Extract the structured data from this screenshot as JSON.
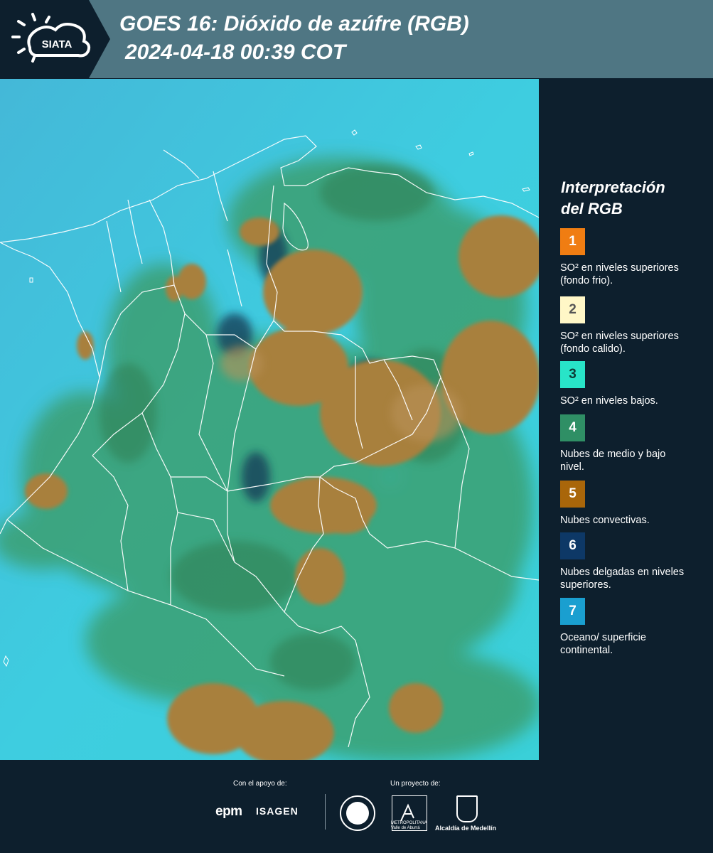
{
  "header": {
    "logo_text": "SIATA",
    "title_line1": "GOES 16: Dióxido de azúfre (RGB)",
    "title_line2": "2024-04-18 00:39 COT"
  },
  "map": {
    "description_icon": "satellite-rgb-image",
    "colors": {
      "background": "#3fc7dc",
      "convective": "#a8803a",
      "low_mid_clouds": "#3c8a5a",
      "thin_high": "#0b3a5a",
      "borders": "#ffffff"
    }
  },
  "legend": {
    "title_line1": "Interpretación",
    "title_line2": "del RGB",
    "items": [
      {
        "number": "1",
        "label": "SO² en niveles superiores (fondo frio).",
        "color": "#f07d12",
        "text_color": "#ffffff"
      },
      {
        "number": "2",
        "label": "SO² en niveles superiores (fondo calido).",
        "color": "#fff7c7",
        "text_color": "#555555"
      },
      {
        "number": "3",
        "label": "SO² en niveles bajos.",
        "color": "#28e4c8",
        "text_color": "#0d3a35"
      },
      {
        "number": "4",
        "label": "Nubes de medio y bajo nivel.",
        "color": "#2f8f65",
        "text_color": "#ffffff"
      },
      {
        "number": "5",
        "label": "Nubes convectivas.",
        "color": "#a9660a",
        "text_color": "#ffffff"
      },
      {
        "number": "6",
        "label": "Nubes delgadas en niveles superiores.",
        "color": "#0d3866",
        "text_color": "#ffffff"
      },
      {
        "number": "7",
        "label": "Oceano/ superficie continental.",
        "color": "#1a9fd0",
        "text_color": "#ffffff"
      }
    ]
  },
  "footer": {
    "support_label": "Con el apoyo de:",
    "project_label": "Un proyecto de:",
    "epm": "epm",
    "isagen": "ISAGEN",
    "area_metropolitana": "METROPOLITANA Valle de Aburrá",
    "alcaldia": "Alcaldía de Medellín"
  }
}
